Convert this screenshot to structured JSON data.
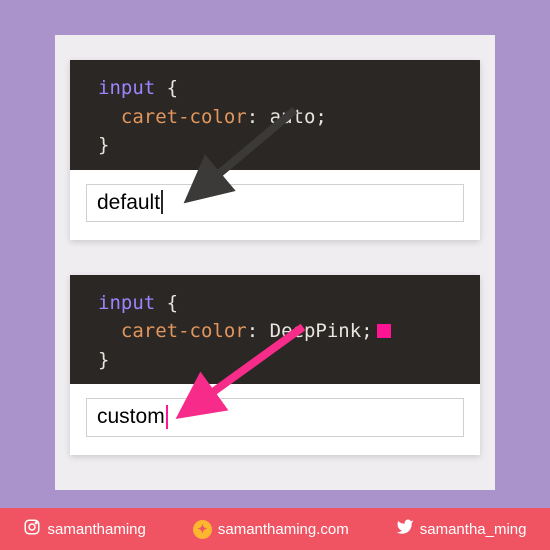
{
  "example1": {
    "selector": "input",
    "prop": "caret-color",
    "value": "auto",
    "input_label": "default",
    "caret_color": "default"
  },
  "example2": {
    "selector": "input",
    "prop": "caret-color",
    "value": "DeepPink",
    "input_label": "custom",
    "caret_color": "DeepPink",
    "swatch_hex": "#f72c8a"
  },
  "footer": {
    "instagram": "samanthaming",
    "website": "samanthaming.com",
    "twitter": "samantha_ming"
  },
  "colors": {
    "bg": "#a993ca",
    "canvas": "#efedf0",
    "code_bg": "#2a2724",
    "selector": "#9b85ff",
    "prop": "#e2965d",
    "accent": "#f05462",
    "yellow": "#fdb62f",
    "deeppink": "#ff1493"
  }
}
